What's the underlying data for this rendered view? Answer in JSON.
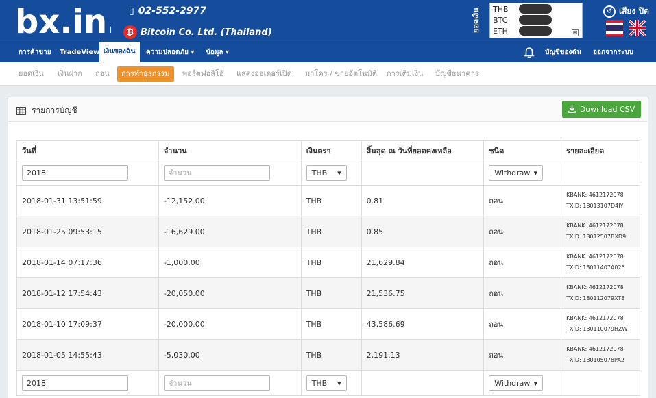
{
  "header": {
    "logo_text": "bx.in.th",
    "phone": "02-552-2977",
    "company": "Bitcoin Co. Ltd. (Thailand)",
    "btc_symbol": "₿",
    "balance_label": "ยอดเงิน",
    "balances": [
      {
        "currency": "THB",
        "value": ""
      },
      {
        "currency": "BTC",
        "value": ""
      },
      {
        "currency": "ETH",
        "value": ""
      }
    ],
    "expand_symbol": "⊞",
    "sound_label": "เสียง ปิด",
    "sound_icon": "↺"
  },
  "nav": {
    "items": [
      "การค้าขาย",
      "TradeView",
      "เงินของฉัน",
      "ความปลอดภัย ▾",
      "ข้อมูล ▾"
    ],
    "account": "บัญชีของฉัน",
    "logout": "ออกจากระบบ"
  },
  "subnav": {
    "items": [
      "ยอดเงิน",
      "เงินฝาก",
      "ถอน",
      "การทำธุรกรรม",
      "พอร์ตฟอลิโอ้",
      "แสดงออเดอร์เปิด",
      "มาโคร / ขายอัตโนมัติ",
      "การเติมเงิน",
      "บัญชีธนาคาร"
    ]
  },
  "panel": {
    "title": "รายการบัญชี",
    "csv_button": "Download CSV",
    "columns": [
      "วันที่",
      "จำนวน",
      "เงินตรา",
      "สิ้นสุด ณ วันที่ยอดคงเหลือ",
      "ชนิด",
      "รายละเอียด"
    ],
    "filter": {
      "date_value": "2018",
      "amount_placeholder": "จำนวน",
      "currency_value": "THB",
      "type_value": "Withdraw"
    },
    "rows": [
      {
        "date": "2018-01-31 13:51:59",
        "amount": "-12,152.00",
        "currency": "THB",
        "balance": "0.81",
        "type": "ถอน",
        "bank": "KBANK: 4612172078",
        "txid": "TXID: 18013107D4IY"
      },
      {
        "date": "2018-01-25 09:53:15",
        "amount": "-16,629.00",
        "currency": "THB",
        "balance": "0.85",
        "type": "ถอน",
        "bank": "KBANK: 4612172078",
        "txid": "TXID: 18012507BXD9"
      },
      {
        "date": "2018-01-14 07:17:36",
        "amount": "-1,000.00",
        "currency": "THB",
        "balance": "21,629.84",
        "type": "ถอน",
        "bank": "KBANK: 4612172078",
        "txid": "TXID: 18011407A025"
      },
      {
        "date": "2018-01-12 17:54:43",
        "amount": "-20,050.00",
        "currency": "THB",
        "balance": "21,536.75",
        "type": "ถอน",
        "bank": "KBANK: 4612172078",
        "txid": "TXID: 180112079XT8"
      },
      {
        "date": "2018-01-10 17:09:37",
        "amount": "-20,000.00",
        "currency": "THB",
        "balance": "43,586.69",
        "type": "ถอน",
        "bank": "KBANK: 4612172078",
        "txid": "TXID: 180110079HZW"
      },
      {
        "date": "2018-01-05 14:55:43",
        "amount": "-5,030.00",
        "currency": "THB",
        "balance": "2,191.13",
        "type": "ถอน",
        "bank": "KBANK: 4612172078",
        "txid": "TXID: 180105078PA2"
      }
    ]
  },
  "colors": {
    "brand_blue": "#154c9c",
    "active_orange": "#f0922c",
    "csv_green": "#4aa63d"
  },
  "icons": {
    "phone": "phone-icon",
    "bell": "bell-icon",
    "table": "table-icon",
    "download": "download-icon",
    "sound": "sound-icon",
    "caret": "caret-down-icon"
  }
}
